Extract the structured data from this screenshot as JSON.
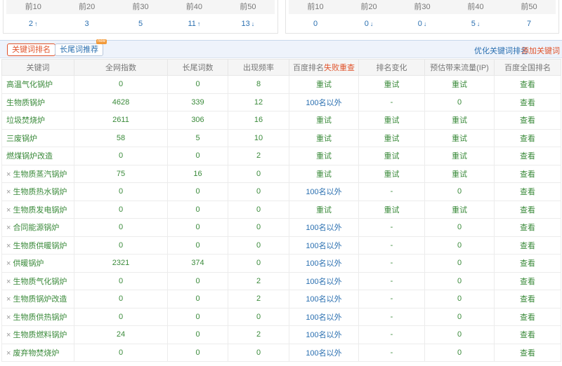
{
  "rank_left": {
    "headers": [
      "前10",
      "前20",
      "前30",
      "前40",
      "前50"
    ],
    "values": [
      {
        "value": "2",
        "trend": "up"
      },
      {
        "value": "3",
        "trend": ""
      },
      {
        "value": "5",
        "trend": ""
      },
      {
        "value": "11",
        "trend": "up"
      },
      {
        "value": "13",
        "trend": "down"
      }
    ]
  },
  "rank_right": {
    "headers": [
      "前10",
      "前20",
      "前30",
      "前40",
      "前50"
    ],
    "values": [
      {
        "value": "0",
        "trend": ""
      },
      {
        "value": "0",
        "trend": "down"
      },
      {
        "value": "0",
        "trend": "down"
      },
      {
        "value": "5",
        "trend": "down"
      },
      {
        "value": "7",
        "trend": ""
      }
    ]
  },
  "arrows": {
    "up": "↑",
    "down": "↓"
  },
  "toolbar": {
    "tab_keyword_rank": "关键词排名",
    "tab_longtail": "长尾词推荐",
    "new_badge": "new",
    "optimize_link": "优化关键词排名",
    "add_link": "添加关键词"
  },
  "table": {
    "headers": {
      "keyword": "关键词",
      "index": "全网指数",
      "longtail": "长尾词数",
      "frequency": "出现频率",
      "baidu_rank": "百度排名",
      "baidu_rank_fail": "失败重查",
      "rank_change": "排名变化",
      "traffic": "预估带来流量(IP)",
      "baidu_all": "百度全国排名"
    },
    "rows": [
      {
        "removable": false,
        "keyword": "高温气化锅炉",
        "index": "0",
        "longtail": "0",
        "frequency": "8",
        "rank": "重试",
        "change": "重试",
        "traffic": "重试",
        "all": "查看"
      },
      {
        "removable": false,
        "keyword": "生物质锅炉",
        "index": "4628",
        "longtail": "339",
        "frequency": "12",
        "rank": "100名以外",
        "change": "-",
        "traffic": "0",
        "all": "查看"
      },
      {
        "removable": false,
        "keyword": "垃圾焚烧炉",
        "index": "2611",
        "longtail": "306",
        "frequency": "16",
        "rank": "重试",
        "change": "重试",
        "traffic": "重试",
        "all": "查看"
      },
      {
        "removable": false,
        "keyword": "三废锅炉",
        "index": "58",
        "longtail": "5",
        "frequency": "10",
        "rank": "重试",
        "change": "重试",
        "traffic": "重试",
        "all": "查看"
      },
      {
        "removable": false,
        "keyword": "燃煤锅炉改造",
        "index": "0",
        "longtail": "0",
        "frequency": "2",
        "rank": "重试",
        "change": "重试",
        "traffic": "重试",
        "all": "查看"
      },
      {
        "removable": true,
        "keyword": "生物质蒸汽锅炉",
        "index": "75",
        "longtail": "16",
        "frequency": "0",
        "rank": "重试",
        "change": "重试",
        "traffic": "重试",
        "all": "查看"
      },
      {
        "removable": true,
        "keyword": "生物质热水锅炉",
        "index": "0",
        "longtail": "0",
        "frequency": "0",
        "rank": "100名以外",
        "change": "-",
        "traffic": "0",
        "all": "查看"
      },
      {
        "removable": true,
        "keyword": "生物质发电锅炉",
        "index": "0",
        "longtail": "0",
        "frequency": "0",
        "rank": "重试",
        "change": "重试",
        "traffic": "重试",
        "all": "查看"
      },
      {
        "removable": true,
        "keyword": "合同能源锅炉",
        "index": "0",
        "longtail": "0",
        "frequency": "0",
        "rank": "100名以外",
        "change": "-",
        "traffic": "0",
        "all": "查看"
      },
      {
        "removable": true,
        "keyword": "生物质供暖锅炉",
        "index": "0",
        "longtail": "0",
        "frequency": "0",
        "rank": "100名以外",
        "change": "-",
        "traffic": "0",
        "all": "查看"
      },
      {
        "removable": true,
        "keyword": "供暖锅炉",
        "index": "2321",
        "longtail": "374",
        "frequency": "0",
        "rank": "100名以外",
        "change": "-",
        "traffic": "0",
        "all": "查看"
      },
      {
        "removable": true,
        "keyword": "生物质气化锅炉",
        "index": "0",
        "longtail": "0",
        "frequency": "2",
        "rank": "100名以外",
        "change": "-",
        "traffic": "0",
        "all": "查看"
      },
      {
        "removable": true,
        "keyword": "生物质锅炉改造",
        "index": "0",
        "longtail": "0",
        "frequency": "2",
        "rank": "100名以外",
        "change": "-",
        "traffic": "0",
        "all": "查看"
      },
      {
        "removable": true,
        "keyword": "生物质供热锅炉",
        "index": "0",
        "longtail": "0",
        "frequency": "0",
        "rank": "100名以外",
        "change": "-",
        "traffic": "0",
        "all": "查看"
      },
      {
        "removable": true,
        "keyword": "生物质燃料锅炉",
        "index": "24",
        "longtail": "0",
        "frequency": "2",
        "rank": "100名以外",
        "change": "-",
        "traffic": "0",
        "all": "查看"
      },
      {
        "removable": true,
        "keyword": "废弃物焚烧炉",
        "index": "0",
        "longtail": "0",
        "frequency": "0",
        "rank": "100名以外",
        "change": "-",
        "traffic": "0",
        "all": "查看"
      }
    ],
    "remove_glyph": "×"
  },
  "colors": {
    "link_blue": "#2a6fb0",
    "accent_orange": "#e0532b",
    "green": "#3a8a3a",
    "up": "#3aa53a",
    "down": "#d9302e"
  }
}
